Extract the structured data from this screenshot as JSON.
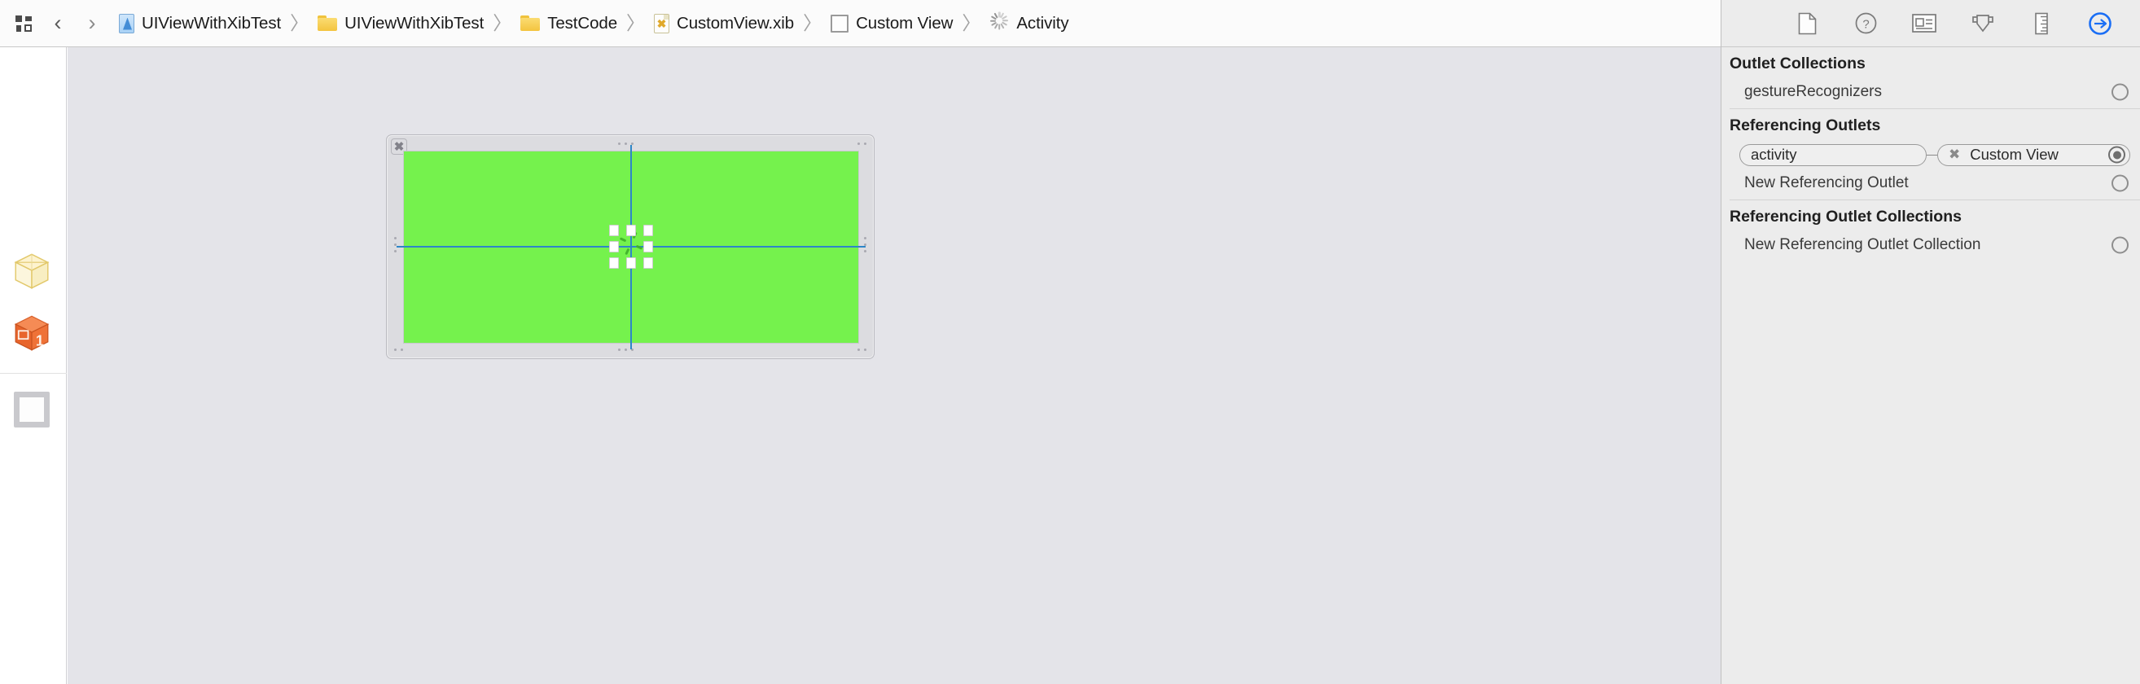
{
  "window": {
    "title": "UIViewWithXibTest — CustomView.xib"
  },
  "jumpbar": {
    "related_items_icon": "grid-icon",
    "back_icon": "chevron-left-icon",
    "forward_icon": "chevron-right-icon",
    "separator": "〉",
    "crumbs": [
      {
        "label": "UIViewWithXibTest",
        "icon": "xcode-project-icon"
      },
      {
        "label": "UIViewWithXibTest",
        "icon": "folder-icon"
      },
      {
        "label": "TestCode",
        "icon": "folder-icon"
      },
      {
        "label": "CustomView.xib",
        "icon": "xib-file-icon"
      },
      {
        "label": "Custom View",
        "icon": "view-square-icon"
      },
      {
        "label": "Activity",
        "icon": "activity-indicator-icon"
      }
    ]
  },
  "dock": {
    "objects": [
      {
        "name": "files-owner-placeholder",
        "icon": "yellow-wireframe-cube-icon"
      },
      {
        "name": "first-responder-placeholder",
        "icon": "orange-cube-one-icon"
      },
      {
        "name": "custom-view-object",
        "icon": "view-square-icon"
      }
    ]
  },
  "canvas": {
    "background_color": "#e4e4e9",
    "view": {
      "name": "Custom View",
      "fill_color": "#75f24d",
      "frame_color": "#dcdce0",
      "close_badge_glyph": "✖"
    },
    "guides": {
      "color": "#2e86c8",
      "vertical": true,
      "horizontal": true
    },
    "selection": {
      "handle_count": 8,
      "handle_color": "#ffffff",
      "selected_object": "Activity Indicator View"
    }
  },
  "inspector": {
    "tools": [
      {
        "name": "file-inspector-icon",
        "selected": false
      },
      {
        "name": "quick-help-inspector-icon",
        "selected": false
      },
      {
        "name": "identity-inspector-icon",
        "selected": false
      },
      {
        "name": "attributes-inspector-icon",
        "selected": false
      },
      {
        "name": "size-inspector-icon",
        "selected": false
      },
      {
        "name": "connections-inspector-icon",
        "selected": true
      }
    ],
    "accent_color": "#1a6ef5",
    "sections": [
      {
        "title": "Outlet Collections",
        "rows": [
          {
            "label": "gestureRecognizers",
            "socket": "empty"
          }
        ]
      },
      {
        "title": "Referencing Outlets",
        "connection": {
          "outlet_name": "activity",
          "target_name": "Custom View",
          "target_star": "✖",
          "socket": "filled"
        },
        "rows": [
          {
            "label": "New Referencing Outlet",
            "socket": "empty"
          }
        ]
      },
      {
        "title": "Referencing Outlet Collections",
        "rows": [
          {
            "label": "New Referencing Outlet Collection",
            "socket": "empty"
          }
        ]
      }
    ]
  }
}
